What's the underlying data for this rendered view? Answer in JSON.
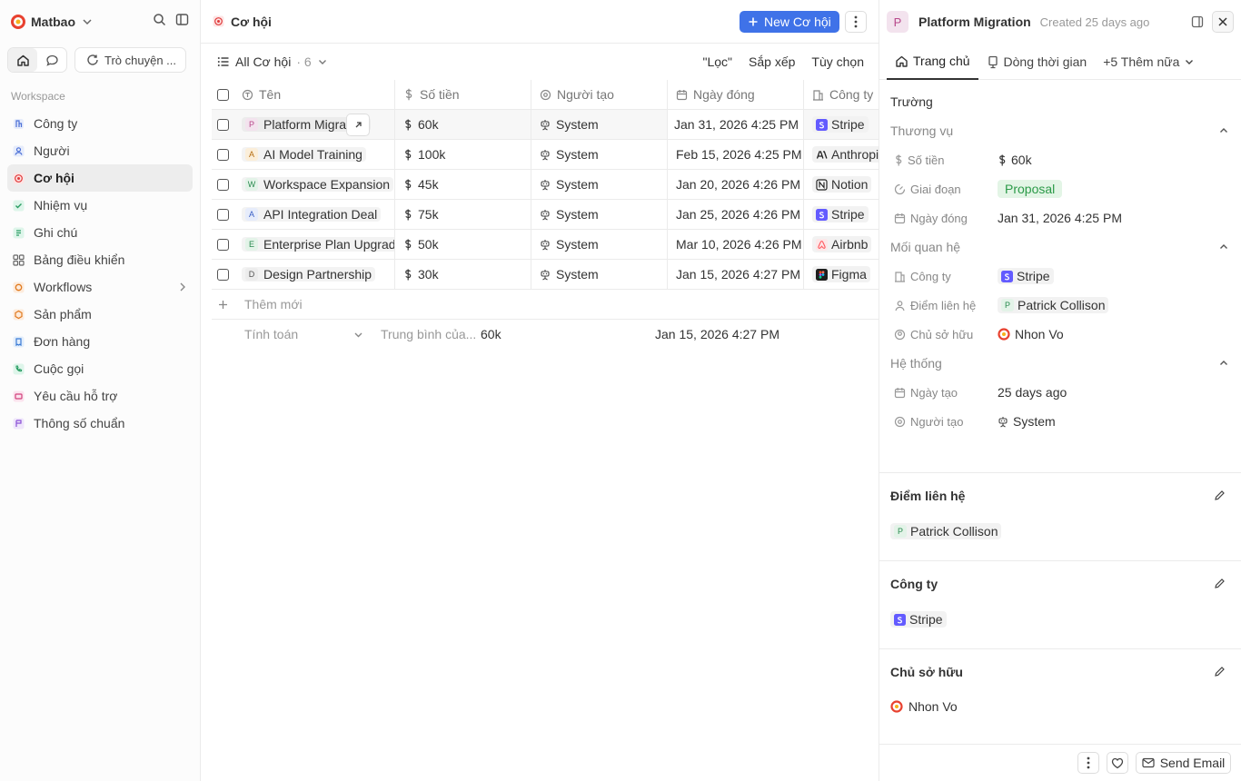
{
  "sidebar": {
    "workspace_name": "Matbao",
    "chat_label": "Trò chuyện ...",
    "section_label": "Workspace",
    "items": [
      {
        "label": "Công ty"
      },
      {
        "label": "Người"
      },
      {
        "label": "Cơ hội"
      },
      {
        "label": "Nhiệm vụ"
      },
      {
        "label": "Ghi chú"
      },
      {
        "label": "Bảng điều khiển"
      },
      {
        "label": "Workflows"
      },
      {
        "label": "Sản phẩm"
      },
      {
        "label": "Đơn hàng"
      },
      {
        "label": "Cuộc gọi"
      },
      {
        "label": "Yêu cầu hỗ trợ"
      },
      {
        "label": "Thông số chuẩn"
      }
    ]
  },
  "main": {
    "title": "Cơ hội",
    "new_button": "New Cơ hội",
    "view_name": "All Cơ hội",
    "view_count": "· 6",
    "filter_label": "\"Lọc\"",
    "sort_label": "Sắp xếp",
    "options_label": "Tùy chọn",
    "columns": [
      "Tên",
      "Số tiền",
      "Người tạo",
      "Ngày đóng",
      "Công ty"
    ],
    "rows": [
      {
        "initial": "P",
        "name": "Platform Migration",
        "amount": "60k",
        "creator": "System",
        "close_date": "Jan 31, 2026 4:25 PM",
        "company": "Stripe"
      },
      {
        "initial": "A",
        "name": "AI Model Training",
        "amount": "100k",
        "creator": "System",
        "close_date": "Feb 15, 2026 4:25 PM",
        "company": "Anthropic"
      },
      {
        "initial": "W",
        "name": "Workspace Expansion",
        "amount": "45k",
        "creator": "System",
        "close_date": "Jan 20, 2026 4:26 PM",
        "company": "Notion"
      },
      {
        "initial": "A",
        "name": "API Integration Deal",
        "amount": "75k",
        "creator": "System",
        "close_date": "Jan 25, 2026 4:26 PM",
        "company": "Stripe"
      },
      {
        "initial": "E",
        "name": "Enterprise Plan Upgrade",
        "amount": "50k",
        "creator": "System",
        "close_date": "Mar 10, 2026 4:26 PM",
        "company": "Airbnb"
      },
      {
        "initial": "D",
        "name": "Design Partnership",
        "amount": "30k",
        "creator": "System",
        "close_date": "Jan 15, 2026 4:27 PM",
        "company": "Figma"
      }
    ],
    "add_new": "Thêm mới",
    "calc_label": "Tính toán",
    "calc_avg_label": "Trung bình của...",
    "calc_avg_value": "60k",
    "calc_date": "Jan 15, 2026 4:27 PM"
  },
  "panel": {
    "initial": "P",
    "title": "Platform Migration",
    "created": "Created 25 days ago",
    "tabs": [
      "Trang chủ",
      "Dòng thời gian",
      "+5 Thêm nữa"
    ],
    "section_title": "Trường",
    "groups": {
      "business": "Thương vụ",
      "relations": "Mối quan hệ",
      "system": "Hệ thống"
    },
    "fields": {
      "amount_label": "Số tiền",
      "amount_value": "60k",
      "stage_label": "Giai đoạn",
      "stage_value": "Proposal",
      "close_label": "Ngày đóng",
      "close_value": "Jan 31, 2026 4:25 PM",
      "company_label": "Công ty",
      "company_value": "Stripe",
      "contact_label": "Điểm liên hệ",
      "contact_initial": "P",
      "contact_value": "Patrick Collison",
      "owner_label": "Chủ sở hữu",
      "owner_value": "Nhon Vo",
      "created_label": "Ngày tạo",
      "created_value": "25 days ago",
      "creator_label": "Người tạo",
      "creator_value": "System"
    },
    "cards": {
      "contact_title": "Điểm liên hệ",
      "contact_initial": "P",
      "contact_value": "Patrick Collison",
      "company_title": "Công ty",
      "company_value": "Stripe",
      "owner_title": "Chủ sở hữu",
      "owner_value": "Nhon Vo"
    },
    "send_email": "Send Email"
  },
  "colors": {
    "accent": "#3f72e8",
    "stage_green": "#2b9a48",
    "stripe": "#635bff",
    "airbnb": "#ff5a5f"
  }
}
